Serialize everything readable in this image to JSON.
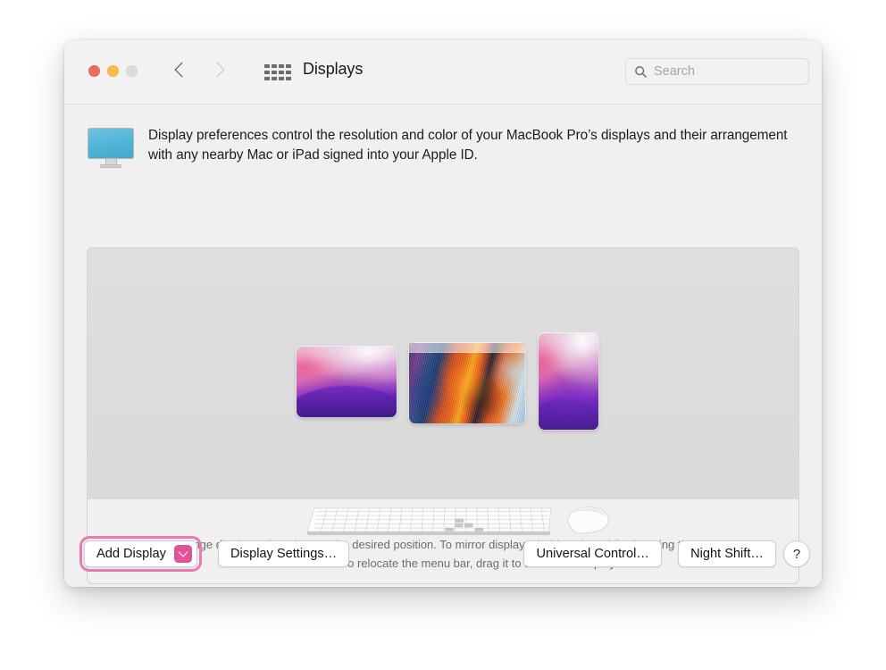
{
  "window": {
    "title": "Displays",
    "traffic_lights": [
      "close",
      "minimize",
      "zoom"
    ],
    "nav": {
      "back": "back-chevron",
      "forward": "forward-chevron"
    },
    "show_all_icon": "grid-icon"
  },
  "search": {
    "placeholder": "Search",
    "value": "",
    "icon": "search-icon"
  },
  "intro": {
    "icon": "display-monitor-icon",
    "text": "Display preferences control the resolution and color of your MacBook Pro’s displays and their arrangement with any nearby Mac or iPad signed into your Apple ID."
  },
  "arrangement": {
    "displays": [
      {
        "id": "display-left",
        "orientation": "landscape",
        "wallpaper": "monterey-purple",
        "has_menu_bar": false
      },
      {
        "id": "display-center",
        "orientation": "landscape",
        "wallpaper": "abstract-orange-blue",
        "has_menu_bar": true
      },
      {
        "id": "display-right",
        "orientation": "portrait",
        "wallpaper": "monterey-purple",
        "has_menu_bar": false
      }
    ],
    "devices": [
      "magic-keyboard",
      "magic-mouse"
    ],
    "hint": "To rearrange displays, drag them to the desired position. To mirror displays, hold Option while dragging them on top of each other. To relocate the menu bar, drag it to a different display."
  },
  "footer": {
    "add_display": {
      "label": "Add Display",
      "chevron_icon": "chevron-down-icon",
      "focused": true,
      "accent_color": "#e0529a",
      "ring_color": "#e87cb0"
    },
    "display_settings": "Display Settings…",
    "universal_control": "Universal Control…",
    "night_shift": "Night Shift…",
    "help": "?"
  }
}
